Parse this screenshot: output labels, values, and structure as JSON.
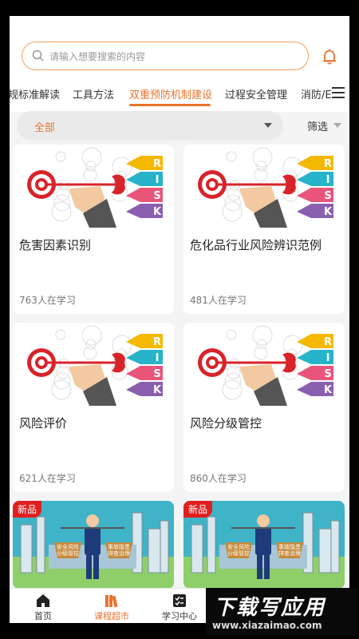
{
  "search": {
    "placeholder": "请输入想要搜索的内容"
  },
  "tabs": [
    {
      "label": "规标准解读"
    },
    {
      "label": "工具方法"
    },
    {
      "label": "双重预防机制建设",
      "active": true
    },
    {
      "label": "过程安全管理"
    },
    {
      "label": "消防/E"
    }
  ],
  "filter": {
    "category": "全部",
    "filter_label": "筛选"
  },
  "courses": [
    {
      "title": "危害因素识别",
      "learners": "763人在学习"
    },
    {
      "title": "危化品行业风险辨识范例",
      "learners": "481人在学习"
    },
    {
      "title": "风险评价",
      "learners": "621人在学习"
    },
    {
      "title": "风险分级管控",
      "learners": "860人在学习"
    }
  ],
  "risk_letters": [
    "R",
    "I",
    "S",
    "K"
  ],
  "promos": [
    {
      "badge": "新品",
      "sign_left": "安全风险分级管控",
      "sign_right": "事故隐患排查治理"
    },
    {
      "badge": "新品",
      "sign_left": "安全风险分级管控",
      "sign_right": "事故隐患排查治理"
    }
  ],
  "bottom_nav": [
    {
      "label": "首页",
      "icon": "home-icon"
    },
    {
      "label": "课程超市",
      "icon": "books-icon",
      "active": true
    },
    {
      "label": "学习中心",
      "icon": "checklist-icon"
    }
  ],
  "watermark": {
    "title": "下载写应用",
    "url": "www.xiazaimao.com"
  },
  "colors": {
    "accent": "#e8732e",
    "badge": "#e02020",
    "risk": [
      "#f5b800",
      "#27b3c9",
      "#e9557a",
      "#8a5fb0"
    ]
  }
}
